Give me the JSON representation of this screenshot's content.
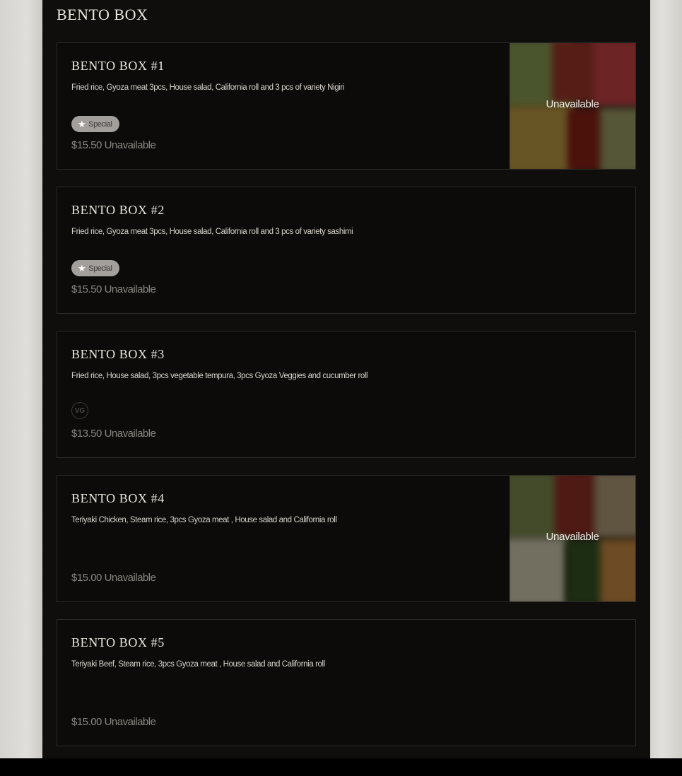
{
  "section": {
    "title": "BENTO BOX"
  },
  "items": [
    {
      "name": "BENTO BOX #1",
      "description": "Fried rice, Gyoza meat 3pcs, House salad, California roll and 3 pcs of variety Nigiri",
      "badge": "Special",
      "price": "$15.50",
      "availability": "Unavailable",
      "image_overlay": "Unavailable"
    },
    {
      "name": "BENTO BOX #2",
      "description": "Fried rice, Gyoza meat 3pcs, House salad, California roll and 3 pcs of variety sashimi",
      "badge": "Special",
      "price": "$15.50",
      "availability": "Unavailable"
    },
    {
      "name": "BENTO BOX #3",
      "description": "Fried rice, House salad, 3pcs vegetable tempura, 3pcs Gyoza Veggies and cucumber roll",
      "diet_tag": "VG",
      "price": "$13.50",
      "availability": "Unavailable"
    },
    {
      "name": "BENTO BOX #4",
      "description": "Teriyaki Chicken, Steam rice, 3pcs Gyoza meat , House salad and California roll",
      "price": "$15.00",
      "availability": "Unavailable",
      "image_overlay": "Unavailable"
    },
    {
      "name": "BENTO BOX #5",
      "description": "Teriyaki Beef, Steam rice, 3pcs Gyoza meat , House salad and California roll",
      "price": "$15.00",
      "availability": "Unavailable"
    }
  ],
  "icons": {
    "badge": "star-icon",
    "diet": "vegan-icon"
  },
  "colors": {
    "panel": "#0f0e0d",
    "card": "#0c0b0a",
    "card_border": "#2c2a27",
    "title_text": "#ece7df",
    "price_text": "#8a8580",
    "badge_bg": "#a3a09c"
  }
}
